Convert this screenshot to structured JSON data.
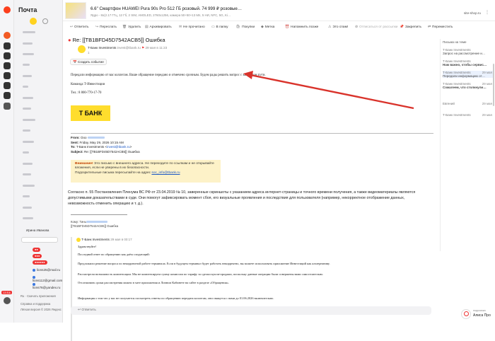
{
  "ad": {
    "title": "6.6\" Смартфон HUAWEI Pura 90s Pro 512 ГБ розовый. 74 999 ₽ розовые…",
    "subtitle": "Ядро - 8x(2.17 ГГц, 12 Гб, 2 SIM, AMOLED, 2760x1256, камера 50+50+13 Мп, 5 НИ, NFC, 5G, Ki…",
    "site": "site-shop.ru"
  },
  "sidebar": {
    "title": "Почта",
    "accounts": [
      "lions25@mail.ru",
      "lions112@gmail.com",
      "lions76@yandex.ru"
    ],
    "footer1": "Справка и поддержка",
    "footer2": "Лёгкая версия  © 2026 Яндекс",
    "badge": "13 Е&",
    "lang": "Ru",
    "apps": "Скачать приложения",
    "contact": "Ирина Иванова"
  },
  "toolbar": [
    "Ответить",
    "Переслать",
    "Удалить",
    "Архивировать",
    "Не прочитано",
    "В папку",
    "Покупки",
    "Метка",
    "Напомнить позже",
    "Это спам!",
    "Отписаться от рассылки",
    "Закрепить",
    "Переместить"
  ],
  "message": {
    "subject": "Re: [[TB1BFD45D7542ACB5]] Ошибка",
    "sender": "T-Банк Investments",
    "sender_email": "invest@tbank.ru",
    "date": "29 мая в 11:23",
    "to_count": "1",
    "action": "Создать событие",
    "p1": "Передали информацию от вас коллегам. Ваше обращение передано и отмечено срочным. Будем рады решить вопрос с закрытым пути.",
    "sign1": "Команда Т-Инвестиции",
    "phone": "Тел.: 8 800-770-17-70",
    "logo": "Т БАНК",
    "from_label": "From:",
    "from_value": "Ооо",
    "sent_label": "Sent:",
    "sent_value": "Friday, May 29, 2026 10:15 AM",
    "to_label": "To:",
    "to_value": "T-Банк Investments",
    "to_email": "invest@tbank.ru",
    "subj_label": "Subject:",
    "subj_value": "Re: [[TB1BFD45D7542ACB5]] Ошибка",
    "warn_bold": "Внимание!",
    "warn_text": "Это письмо с внешнего адреса. Не переходите по ссылкам и не открывайте вложения, если не уверены в их безопасности.",
    "warn_text2": "Подозрительные письма пересылайте на адрес",
    "warn_link": "soc_info@tbank.ru",
    "legal": "Согласно п. 55 Постановления Пленума ВС РФ от 23.04.2019 № 10, заверенные скриншоты с указанием адреса интернет-страницы и точного времени получения, а также видеоматериалы являются допустимыми доказательствами в суде. Они помогут зафиксировать момент сбоя, его визуальные проявления и последствия для пользователя (например, некорректное отображение данных, невозможность отменить операцию и т. д.).",
    "q_from": "Кому: Тинь",
    "q_subj": "[[TB1BFD45D7542ACB5]] Ошибка",
    "q_sender": "Т-Банк Investments",
    "q_date": "29 мая в 00:17",
    "q1": "Здравствуйте!",
    "q2": "Последний ответ по обращению как даём следующий:",
    "q3": "Предложили решение вопроса по некорректной работе терминала. Если в будущем терминал будет работать некорректно, вы можете использовать приложение Инвестиций как альтернативу.",
    "q4": "Рассмотрели возможность компенсации. Мы не компенсируем сумму комиссии по тарифу за сделки купли-продажи, поскольку данные операции были совершены вами самостоятельно.",
    "q5": "Отслеживать сроки рассмотрения можно в чате приложения и Личном Кабинете на сайте в разделе «Обращения».",
    "q6": "Информация о том что у вас не получается посмотреть ответы по обращению передана коллегам, они свяжутся с вами до 01.06.2026 включительно.",
    "reply": "Ответить"
  },
  "right_panel": {
    "header": "Письма на теме",
    "items": [
      {
        "from": "Т-Банк Investments",
        "subject": "Запрос на рассмотрение и…",
        "time": ""
      },
      {
        "from": "Т-Банк Investments",
        "subject": "Нам важно, чтобы сервис…",
        "time": ""
      },
      {
        "from": "Т-Банк Investments",
        "subject": "Передали информацию от…",
        "time": "29 мая"
      },
      {
        "from": "Т-Банк Investments",
        "subject": "Сожалеем, что столкнули…",
        "time": "29 мая"
      },
      {
        "from": "Евгений",
        "subject": "",
        "time": "29 мая"
      },
      {
        "from": "Т-Банк Investments",
        "subject": "",
        "time": "29 мая"
      }
    ]
  },
  "alice": {
    "label": "Алиса Про",
    "sub": "подсказка"
  }
}
